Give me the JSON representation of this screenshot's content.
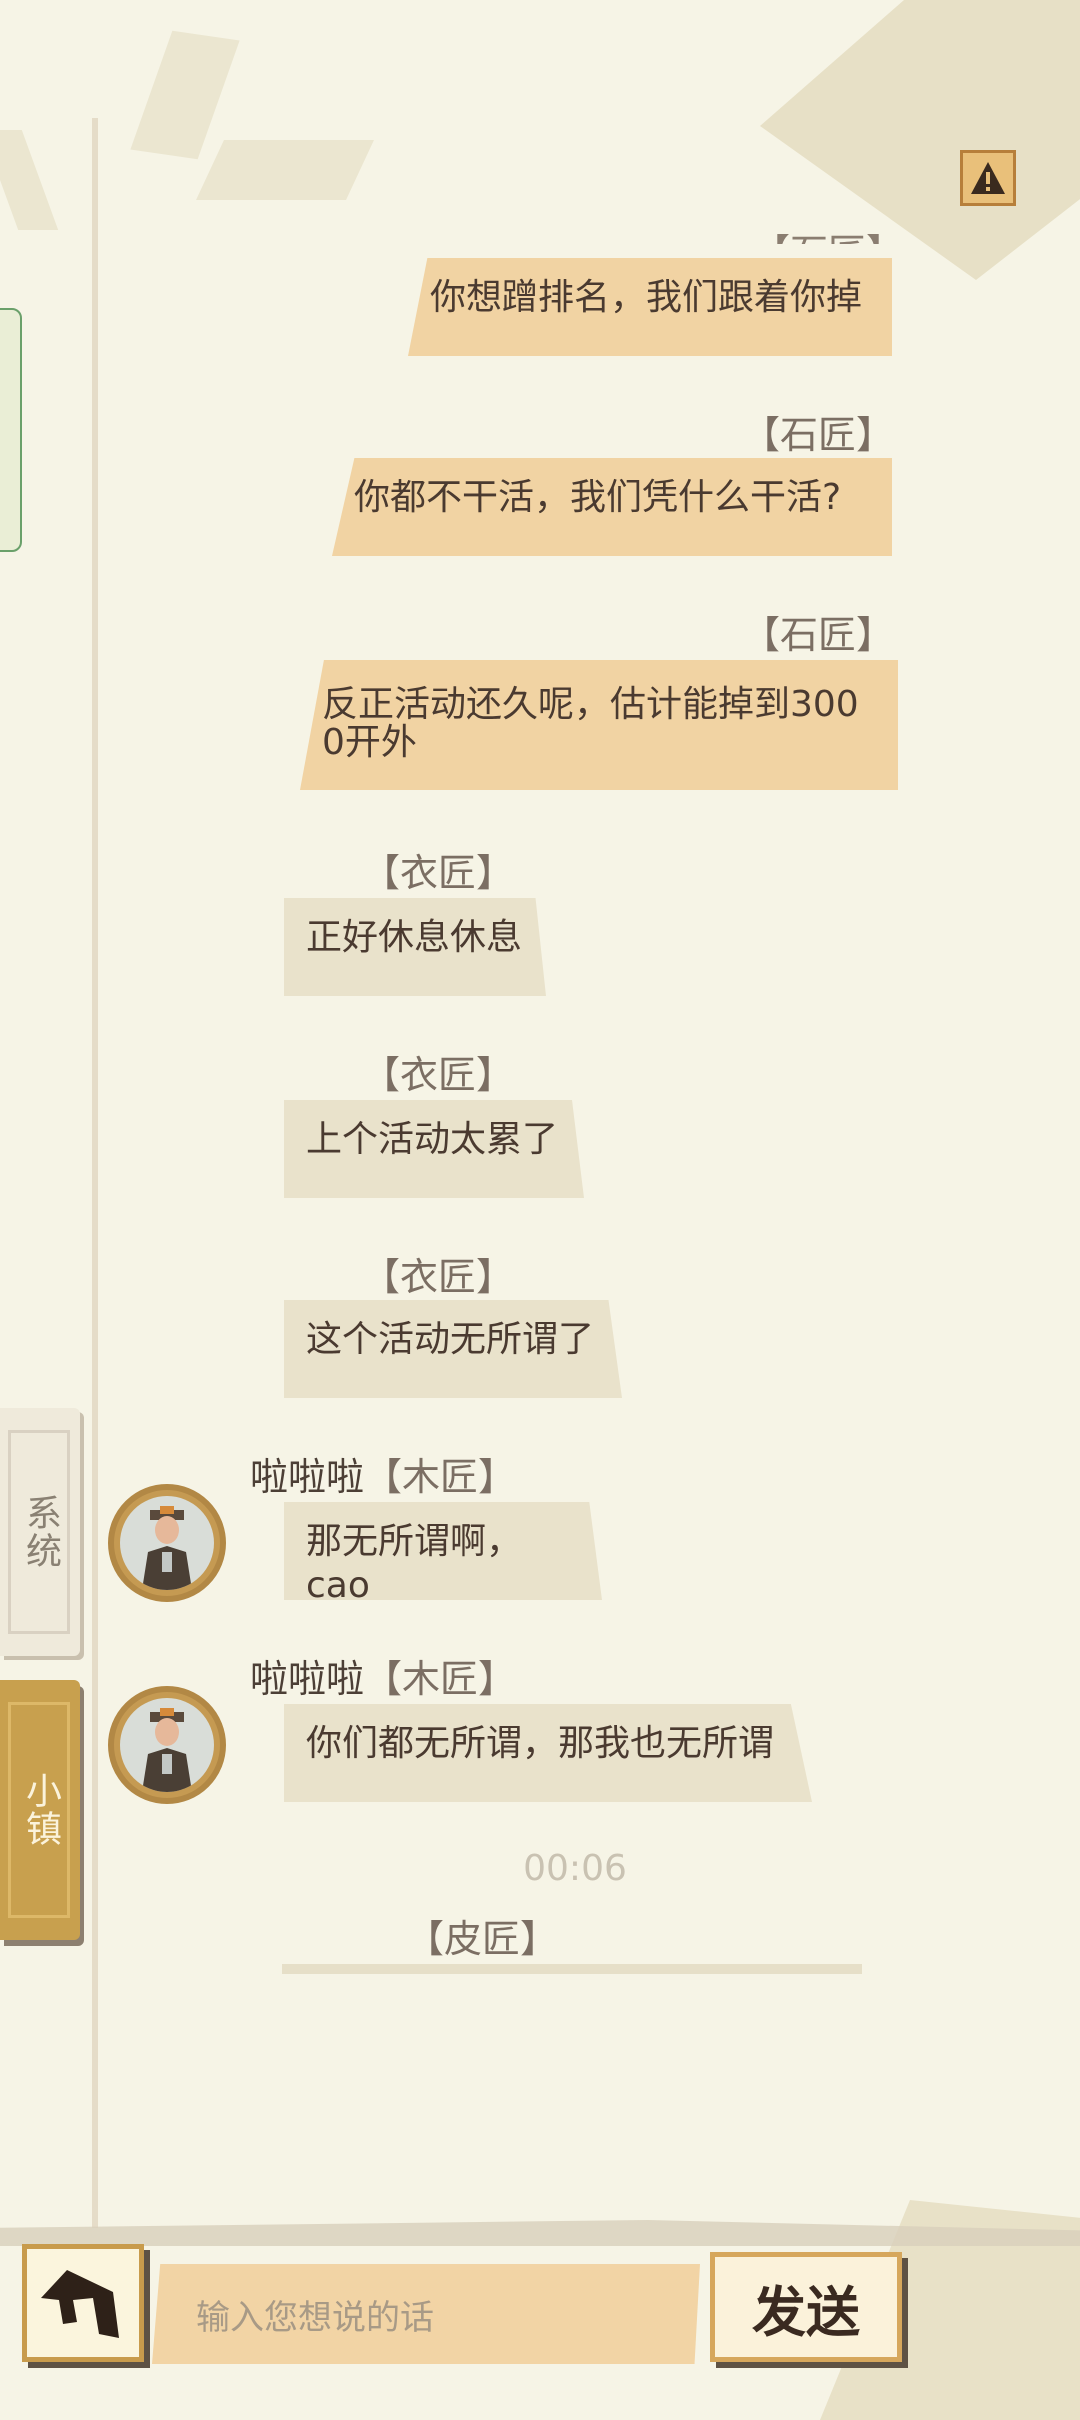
{
  "alert_icon": "warning-icon",
  "side_tabs": {
    "system": "系统",
    "town": "小镇"
  },
  "messages": [
    {
      "name": "【石匠】",
      "text": "你想蹭排名，我们跟着你掉",
      "side": "right"
    },
    {
      "name": "【石匠】",
      "text": "你都不干活，我们凭什么干活?",
      "side": "right"
    },
    {
      "name": "【石匠】",
      "text": "反正活动还久呢，估计能掉到3000开外",
      "side": "right"
    },
    {
      "name": "【衣匠】",
      "text": "正好休息休息",
      "side": "left"
    },
    {
      "name": "【衣匠】",
      "text": "上个活动太累了",
      "side": "left"
    },
    {
      "name": "【衣匠】",
      "text": "这个活动无所谓了",
      "side": "left"
    },
    {
      "user": "啦啦啦",
      "name": "【木匠】",
      "text": "那无所谓啊，cao",
      "side": "left"
    },
    {
      "user": "啦啦啦",
      "name": "【木匠】",
      "text": "你们都无所谓，那我也无所谓",
      "side": "left"
    }
  ],
  "time_label": "00:06",
  "pending_name": "【皮匠】",
  "input": {
    "placeholder": "输入您想说的话"
  },
  "send_label": "发送",
  "colors": {
    "background": "#f6f4e6",
    "bubble_right": "#f1d3a3",
    "bubble_left": "#e9e2cb",
    "town_tab": "#c8a04e"
  }
}
